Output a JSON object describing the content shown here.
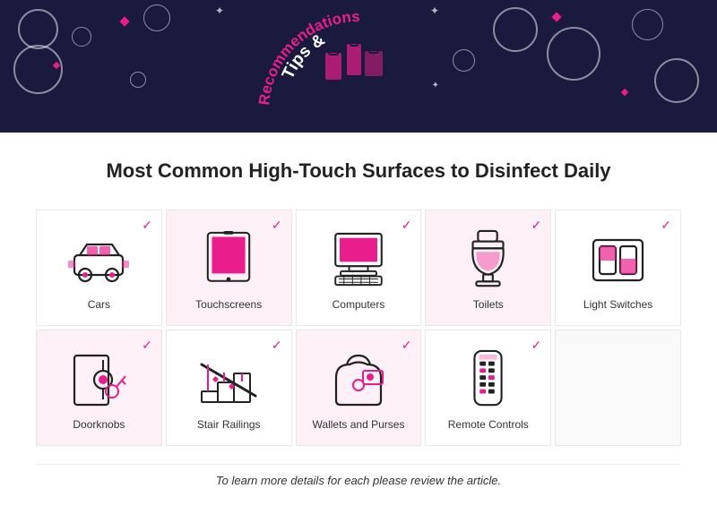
{
  "header": {
    "title_line1": "Tips &",
    "title_line2": "Recommendations"
  },
  "section_title": "Most Common High-Touch Surfaces to Disinfect Daily",
  "items_row1": [
    {
      "label": "Cars",
      "icon": "car"
    },
    {
      "label": "Touchscreens",
      "icon": "tablet"
    },
    {
      "label": "Computers",
      "icon": "computer"
    },
    {
      "label": "Toilets",
      "icon": "toilet"
    },
    {
      "label": "Light Switches",
      "icon": "lightswitch"
    }
  ],
  "items_row2": [
    {
      "label": "Doorknobs",
      "icon": "doorknob"
    },
    {
      "label": "Stair Railings",
      "icon": "stairrailing"
    },
    {
      "label": "Wallets and Purses",
      "icon": "wallet"
    },
    {
      "label": "Remote Controls",
      "icon": "remote"
    },
    {
      "label": "",
      "icon": "none"
    }
  ],
  "footer": {
    "note": "To learn more details for each please review the article."
  }
}
